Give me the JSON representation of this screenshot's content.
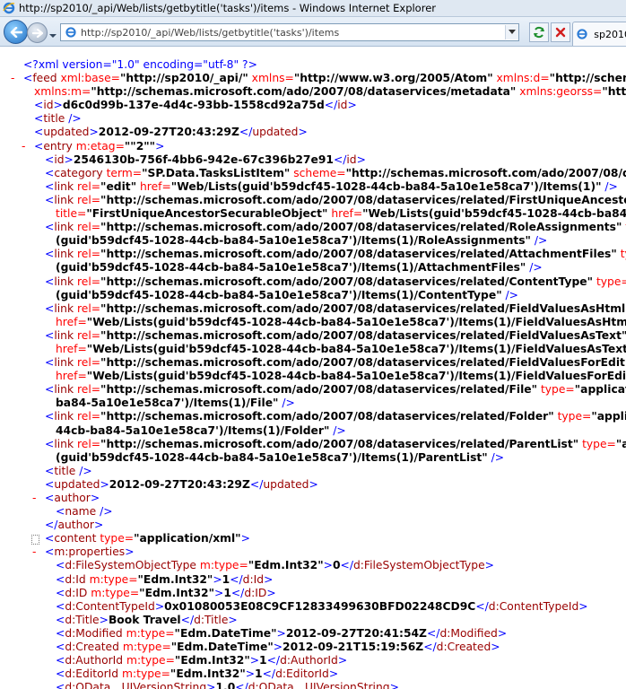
{
  "window": {
    "title": "http://sp2010/_api/Web/lists/getbytitle('tasks')/items - Windows Internet Explorer"
  },
  "address_bar": {
    "url": "http://sp2010/_api/Web/lists/getbytitle('tasks')/items"
  },
  "tab": {
    "label": "sp2010"
  },
  "xml_lines": [
    {
      "indent": 0,
      "collapse": "",
      "parts": [
        [
          "b",
          "<?xml version=\"1.0\" encoding=\"utf-8\" ?>"
        ]
      ]
    },
    {
      "indent": 0,
      "collapse": "-",
      "parts": [
        [
          "b",
          "<"
        ],
        [
          "rb",
          "feed"
        ],
        [
          "m",
          " xml:base="
        ],
        [
          "k",
          "\"http://sp2010/_api/\""
        ],
        [
          "m",
          " xmlns="
        ],
        [
          "k",
          "\"http://www.w3.org/2005/Atom\""
        ],
        [
          "m",
          " xmlns:d="
        ],
        [
          "k",
          "\"http://schema"
        ]
      ]
    },
    {
      "indent": 1,
      "collapse": "",
      "parts": [
        [
          "m",
          "xmlns:m="
        ],
        [
          "k",
          "\"http://schemas.microsoft.com/ado/2007/08/dataservices/metadata\""
        ],
        [
          "m",
          " xmlns:georss="
        ],
        [
          "k",
          "\"http:"
        ]
      ]
    },
    {
      "indent": 1,
      "collapse": "",
      "parts": [
        [
          "b",
          "<"
        ],
        [
          "rb",
          "id"
        ],
        [
          "b",
          ">"
        ],
        [
          "k",
          "d6c0d99b-137e-4d4c-93bb-1558cd92a75d"
        ],
        [
          "b",
          "</"
        ],
        [
          "rb",
          "id"
        ],
        [
          "b",
          ">"
        ]
      ]
    },
    {
      "indent": 1,
      "collapse": "",
      "parts": [
        [
          "b",
          "<"
        ],
        [
          "rb",
          "title"
        ],
        [
          "b",
          " />"
        ]
      ]
    },
    {
      "indent": 1,
      "collapse": "",
      "parts": [
        [
          "b",
          "<"
        ],
        [
          "rb",
          "updated"
        ],
        [
          "b",
          ">"
        ],
        [
          "k",
          "2012-09-27T20:43:29Z"
        ],
        [
          "b",
          "</"
        ],
        [
          "rb",
          "updated"
        ],
        [
          "b",
          ">"
        ]
      ]
    },
    {
      "indent": 1,
      "collapse": "-",
      "parts": [
        [
          "b",
          "<"
        ],
        [
          "rb",
          "entry"
        ],
        [
          "m",
          " m:etag="
        ],
        [
          "k",
          "\"\"2\"\""
        ],
        [
          "b",
          ">"
        ]
      ]
    },
    {
      "indent": 2,
      "collapse": "",
      "parts": [
        [
          "b",
          "<"
        ],
        [
          "rb",
          "id"
        ],
        [
          "b",
          ">"
        ],
        [
          "k",
          "2546130b-756f-4bb6-942e-67c396b27e91"
        ],
        [
          "b",
          "</"
        ],
        [
          "rb",
          "id"
        ],
        [
          "b",
          ">"
        ]
      ]
    },
    {
      "indent": 2,
      "collapse": "",
      "parts": [
        [
          "b",
          "<"
        ],
        [
          "rb",
          "category"
        ],
        [
          "m",
          " term="
        ],
        [
          "k",
          "\"SP.Data.TasksListItem\""
        ],
        [
          "m",
          " scheme="
        ],
        [
          "k",
          "\"http://schemas.microsoft.com/ado/2007/08/dat"
        ]
      ]
    },
    {
      "indent": 2,
      "collapse": "",
      "parts": [
        [
          "b",
          "<"
        ],
        [
          "rb",
          "link"
        ],
        [
          "m",
          " rel="
        ],
        [
          "k",
          "\"edit\""
        ],
        [
          "m",
          " href="
        ],
        [
          "k",
          "\"Web/Lists(guid'b59dcf45-1028-44cb-ba84-5a10e1e58ca7')/Items(1)\""
        ],
        [
          "b",
          " />"
        ]
      ]
    },
    {
      "indent": 2,
      "collapse": "",
      "parts": [
        [
          "b",
          "<"
        ],
        [
          "rb",
          "link"
        ],
        [
          "m",
          " rel="
        ],
        [
          "k",
          "\"http://schemas.microsoft.com/ado/2007/08/dataservices/related/FirstUniqueAncestor"
        ]
      ]
    },
    {
      "indent": 3,
      "collapse": "",
      "parts": [
        [
          "m",
          "title="
        ],
        [
          "k",
          "\"FirstUniqueAncestorSecurableObject\""
        ],
        [
          "m",
          " href="
        ],
        [
          "k",
          "\"Web/Lists(guid'b59dcf45-1028-44cb-ba84-5a10"
        ]
      ]
    },
    {
      "indent": 2,
      "collapse": "",
      "parts": [
        [
          "b",
          "<"
        ],
        [
          "rb",
          "link"
        ],
        [
          "m",
          " rel="
        ],
        [
          "k",
          "\"http://schemas.microsoft.com/ado/2007/08/dataservices/related/RoleAssignments\""
        ],
        [
          "m",
          " ty"
        ]
      ]
    },
    {
      "indent": 3,
      "collapse": "",
      "parts": [
        [
          "k",
          "(guid'b59dcf45-1028-44cb-ba84-5a10e1e58ca7')/Items(1)/RoleAssignments\""
        ],
        [
          "b",
          " />"
        ]
      ]
    },
    {
      "indent": 2,
      "collapse": "",
      "parts": [
        [
          "b",
          "<"
        ],
        [
          "rb",
          "link"
        ],
        [
          "m",
          " rel="
        ],
        [
          "k",
          "\"http://schemas.microsoft.com/ado/2007/08/dataservices/related/AttachmentFiles\""
        ],
        [
          "m",
          " ty"
        ]
      ]
    },
    {
      "indent": 3,
      "collapse": "",
      "parts": [
        [
          "k",
          "(guid'b59dcf45-1028-44cb-ba84-5a10e1e58ca7')/Items(1)/AttachmentFiles\""
        ],
        [
          "b",
          " />"
        ]
      ]
    },
    {
      "indent": 2,
      "collapse": "",
      "parts": [
        [
          "b",
          "<"
        ],
        [
          "rb",
          "link"
        ],
        [
          "m",
          " rel="
        ],
        [
          "k",
          "\"http://schemas.microsoft.com/ado/2007/08/dataservices/related/ContentType\""
        ],
        [
          "m",
          " type="
        ]
      ]
    },
    {
      "indent": 3,
      "collapse": "",
      "parts": [
        [
          "k",
          "(guid'b59dcf45-1028-44cb-ba84-5a10e1e58ca7')/Items(1)/ContentType\""
        ],
        [
          "b",
          " />"
        ]
      ]
    },
    {
      "indent": 2,
      "collapse": "",
      "parts": [
        [
          "b",
          "<"
        ],
        [
          "rb",
          "link"
        ],
        [
          "m",
          " rel="
        ],
        [
          "k",
          "\"http://schemas.microsoft.com/ado/2007/08/dataservices/related/FieldValuesAsHtml\""
        ]
      ]
    },
    {
      "indent": 3,
      "collapse": "",
      "parts": [
        [
          "m",
          "href="
        ],
        [
          "k",
          "\"Web/Lists(guid'b59dcf45-1028-44cb-ba84-5a10e1e58ca7')/Items(1)/FieldValuesAsHtml\""
        ]
      ]
    },
    {
      "indent": 2,
      "collapse": "",
      "parts": [
        [
          "b",
          "<"
        ],
        [
          "rb",
          "link"
        ],
        [
          "m",
          " rel="
        ],
        [
          "k",
          "\"http://schemas.microsoft.com/ado/2007/08/dataservices/related/FieldValuesAsText\""
        ]
      ]
    },
    {
      "indent": 3,
      "collapse": "",
      "parts": [
        [
          "m",
          "href="
        ],
        [
          "k",
          "\"Web/Lists(guid'b59dcf45-1028-44cb-ba84-5a10e1e58ca7')/Items(1)/FieldValuesAsText\""
        ]
      ]
    },
    {
      "indent": 2,
      "collapse": "",
      "parts": [
        [
          "b",
          "<"
        ],
        [
          "rb",
          "link"
        ],
        [
          "m",
          " rel="
        ],
        [
          "k",
          "\"http://schemas.microsoft.com/ado/2007/08/dataservices/related/FieldValuesForEdit\""
        ]
      ]
    },
    {
      "indent": 3,
      "collapse": "",
      "parts": [
        [
          "m",
          "href="
        ],
        [
          "k",
          "\"Web/Lists(guid'b59dcf45-1028-44cb-ba84-5a10e1e58ca7')/Items(1)/FieldValuesForEdit\""
        ]
      ]
    },
    {
      "indent": 2,
      "collapse": "",
      "parts": [
        [
          "b",
          "<"
        ],
        [
          "rb",
          "link"
        ],
        [
          "m",
          " rel="
        ],
        [
          "k",
          "\"http://schemas.microsoft.com/ado/2007/08/dataservices/related/File\""
        ],
        [
          "m",
          " type="
        ],
        [
          "k",
          "\"applicatio"
        ]
      ]
    },
    {
      "indent": 3,
      "collapse": "",
      "parts": [
        [
          "k",
          "ba84-5a10e1e58ca7')/Items(1)/File\""
        ],
        [
          "b",
          " />"
        ]
      ]
    },
    {
      "indent": 2,
      "collapse": "",
      "parts": [
        [
          "b",
          "<"
        ],
        [
          "rb",
          "link"
        ],
        [
          "m",
          " rel="
        ],
        [
          "k",
          "\"http://schemas.microsoft.com/ado/2007/08/dataservices/related/Folder\""
        ],
        [
          "m",
          " type="
        ],
        [
          "k",
          "\"applica"
        ]
      ]
    },
    {
      "indent": 3,
      "collapse": "",
      "parts": [
        [
          "k",
          "44cb-ba84-5a10e1e58ca7')/Items(1)/Folder\""
        ],
        [
          "b",
          " />"
        ]
      ]
    },
    {
      "indent": 2,
      "collapse": "",
      "parts": [
        [
          "b",
          "<"
        ],
        [
          "rb",
          "link"
        ],
        [
          "m",
          " rel="
        ],
        [
          "k",
          "\"http://schemas.microsoft.com/ado/2007/08/dataservices/related/ParentList\""
        ],
        [
          "m",
          " type="
        ],
        [
          "k",
          "\"ap"
        ]
      ]
    },
    {
      "indent": 3,
      "collapse": "",
      "parts": [
        [
          "k",
          "(guid'b59dcf45-1028-44cb-ba84-5a10e1e58ca7')/Items(1)/ParentList\""
        ],
        [
          "b",
          " />"
        ]
      ]
    },
    {
      "indent": 2,
      "collapse": "",
      "parts": [
        [
          "b",
          "<"
        ],
        [
          "rb",
          "title"
        ],
        [
          "b",
          " />"
        ]
      ]
    },
    {
      "indent": 2,
      "collapse": "",
      "parts": [
        [
          "b",
          "<"
        ],
        [
          "rb",
          "updated"
        ],
        [
          "b",
          ">"
        ],
        [
          "k",
          "2012-09-27T20:43:29Z"
        ],
        [
          "b",
          "</"
        ],
        [
          "rb",
          "updated"
        ],
        [
          "b",
          ">"
        ]
      ]
    },
    {
      "indent": 2,
      "collapse": "-",
      "parts": [
        [
          "b",
          "<"
        ],
        [
          "rb",
          "author"
        ],
        [
          "b",
          ">"
        ]
      ]
    },
    {
      "indent": 3,
      "collapse": "",
      "parts": [
        [
          "b",
          "<"
        ],
        [
          "rb",
          "name"
        ],
        [
          "b",
          " />"
        ]
      ]
    },
    {
      "indent": 2,
      "collapse": "",
      "parts": [
        [
          "b",
          "</"
        ],
        [
          "rb",
          "author"
        ],
        [
          "b",
          ">"
        ]
      ]
    },
    {
      "indent": 2,
      "collapse": "box",
      "parts": [
        [
          "b",
          "<"
        ],
        [
          "rb",
          "content"
        ],
        [
          "m",
          " type="
        ],
        [
          "k",
          "\"application/xml\""
        ],
        [
          "b",
          ">"
        ]
      ]
    },
    {
      "indent": 2,
      "collapse": "-",
      "parts": [
        [
          "b",
          "  <"
        ],
        [
          "rb",
          "m:properties"
        ],
        [
          "b",
          ">"
        ]
      ]
    },
    {
      "indent": 3,
      "collapse": "",
      "parts": [
        [
          "b",
          "  <"
        ],
        [
          "rb",
          "d:FileSystemObjectType"
        ],
        [
          "m",
          " m:type="
        ],
        [
          "k",
          "\"Edm.Int32\""
        ],
        [
          "b",
          ">"
        ],
        [
          "k",
          "0"
        ],
        [
          "b",
          "</"
        ],
        [
          "rb",
          "d:FileSystemObjectType"
        ],
        [
          "b",
          ">"
        ]
      ]
    },
    {
      "indent": 3,
      "collapse": "",
      "parts": [
        [
          "b",
          "  <"
        ],
        [
          "rb",
          "d:Id"
        ],
        [
          "m",
          " m:type="
        ],
        [
          "k",
          "\"Edm.Int32\""
        ],
        [
          "b",
          ">"
        ],
        [
          "k",
          "1"
        ],
        [
          "b",
          "</"
        ],
        [
          "rb",
          "d:Id"
        ],
        [
          "b",
          ">"
        ]
      ]
    },
    {
      "indent": 3,
      "collapse": "",
      "parts": [
        [
          "b",
          "  <"
        ],
        [
          "rb",
          "d:ID"
        ],
        [
          "m",
          " m:type="
        ],
        [
          "k",
          "\"Edm.Int32\""
        ],
        [
          "b",
          ">"
        ],
        [
          "k",
          "1"
        ],
        [
          "b",
          "</"
        ],
        [
          "rb",
          "d:ID"
        ],
        [
          "b",
          ">"
        ]
      ]
    },
    {
      "indent": 3,
      "collapse": "",
      "parts": [
        [
          "b",
          "  <"
        ],
        [
          "rb",
          "d:ContentTypeId"
        ],
        [
          "b",
          ">"
        ],
        [
          "k",
          "0x01080053E08C9CF12833499630BFD02248CD9C"
        ],
        [
          "b",
          "</"
        ],
        [
          "rb",
          "d:ContentTypeId"
        ],
        [
          "b",
          ">"
        ]
      ]
    },
    {
      "indent": 3,
      "collapse": "",
      "parts": [
        [
          "b",
          "  <"
        ],
        [
          "rb",
          "d:Title"
        ],
        [
          "b",
          ">"
        ],
        [
          "k",
          "Book Travel"
        ],
        [
          "b",
          "</"
        ],
        [
          "rb",
          "d:Title"
        ],
        [
          "b",
          ">"
        ]
      ]
    },
    {
      "indent": 3,
      "collapse": "",
      "parts": [
        [
          "b",
          "  <"
        ],
        [
          "rb",
          "d:Modified"
        ],
        [
          "m",
          " m:type="
        ],
        [
          "k",
          "\"Edm.DateTime\""
        ],
        [
          "b",
          ">"
        ],
        [
          "k",
          "2012-09-27T20:41:54Z"
        ],
        [
          "b",
          "</"
        ],
        [
          "rb",
          "d:Modified"
        ],
        [
          "b",
          ">"
        ]
      ]
    },
    {
      "indent": 3,
      "collapse": "",
      "parts": [
        [
          "b",
          "  <"
        ],
        [
          "rb",
          "d:Created"
        ],
        [
          "m",
          " m:type="
        ],
        [
          "k",
          "\"Edm.DateTime\""
        ],
        [
          "b",
          ">"
        ],
        [
          "k",
          "2012-09-21T15:19:56Z"
        ],
        [
          "b",
          "</"
        ],
        [
          "rb",
          "d:Created"
        ],
        [
          "b",
          ">"
        ]
      ]
    },
    {
      "indent": 3,
      "collapse": "",
      "parts": [
        [
          "b",
          "  <"
        ],
        [
          "rb",
          "d:AuthorId"
        ],
        [
          "m",
          " m:type="
        ],
        [
          "k",
          "\"Edm.Int32\""
        ],
        [
          "b",
          ">"
        ],
        [
          "k",
          "1"
        ],
        [
          "b",
          "</"
        ],
        [
          "rb",
          "d:AuthorId"
        ],
        [
          "b",
          ">"
        ]
      ]
    },
    {
      "indent": 3,
      "collapse": "",
      "parts": [
        [
          "b",
          "  <"
        ],
        [
          "rb",
          "d:EditorId"
        ],
        [
          "m",
          " m:type="
        ],
        [
          "k",
          "\"Edm.Int32\""
        ],
        [
          "b",
          ">"
        ],
        [
          "k",
          "1"
        ],
        [
          "b",
          "</"
        ],
        [
          "rb",
          "d:EditorId"
        ],
        [
          "b",
          ">"
        ]
      ]
    },
    {
      "indent": 3,
      "collapse": "",
      "parts": [
        [
          "b",
          "  <"
        ],
        [
          "rb",
          "d:OData__UIVersionString"
        ],
        [
          "b",
          ">"
        ],
        [
          "k",
          "1.0"
        ],
        [
          "b",
          "</"
        ],
        [
          "rb",
          "d:OData__UIVersionString"
        ],
        [
          "b",
          ">"
        ]
      ]
    }
  ]
}
